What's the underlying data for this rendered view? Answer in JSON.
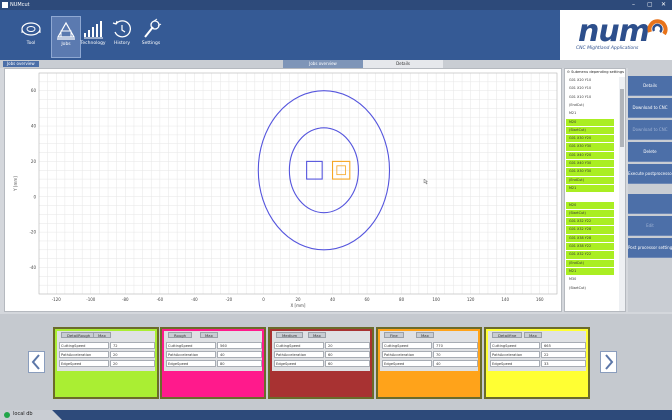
{
  "window": {
    "title": "NUMcut"
  },
  "nav": [
    {
      "label": "Tool",
      "icon": "tool-icon",
      "active": false
    },
    {
      "label": "Jobs",
      "icon": "jobs-icon",
      "active": true
    },
    {
      "label": "Technology",
      "icon": "technology-icon",
      "active": false
    },
    {
      "label": "History",
      "icon": "history-icon",
      "active": false
    },
    {
      "label": "Settings",
      "icon": "settings-icon",
      "active": false
    }
  ],
  "brand": {
    "name": "num",
    "tagline": "CNC Mightland Applications"
  },
  "breadcrumb": "Jobs overview",
  "tabs": [
    {
      "label": "Jobs overview"
    },
    {
      "label": "Details"
    }
  ],
  "plot": {
    "xlabel": "X [mm]",
    "ylabel": "Y [mm]",
    "xticks": [
      "-120",
      "-100",
      "-80",
      "-60",
      "-40",
      "-20",
      "0",
      "20",
      "40",
      "60",
      "80",
      "100",
      "120",
      "140",
      "160"
    ],
    "yticks": [
      "60",
      "40",
      "20",
      "0",
      "-20",
      "-40"
    ],
    "colors": {
      "path": "#5555dd",
      "selected": "#f5a623",
      "grid": "#e6e6e6"
    }
  },
  "program_list": {
    "header": "Submenu depending settings",
    "lines": [
      {
        "text": "G01 X20 Y10",
        "hl": false
      },
      {
        "text": "G01 X20 Y10",
        "hl": false
      },
      {
        "text": "G01 X10 Y10",
        "hl": false
      },
      {
        "text": "(EndCut)",
        "hl": false
      },
      {
        "text": "M21",
        "hl": false
      },
      {
        "text": "M20",
        "hl": true
      },
      {
        "text": "(StartCut)",
        "hl": true
      },
      {
        "text": "G01 X30 Y20",
        "hl": true
      },
      {
        "text": "G01 X30 Y30",
        "hl": true
      },
      {
        "text": "G01 X40 Y20",
        "hl": true
      },
      {
        "text": "G01 X40 Y30",
        "hl": true
      },
      {
        "text": "G01 X30 Y30",
        "hl": true
      },
      {
        "text": "(EndCut)",
        "hl": true
      },
      {
        "text": "M21",
        "hl": true
      },
      {
        "text": "",
        "hl": false
      },
      {
        "text": "M20",
        "hl": true
      },
      {
        "text": "(StartCut)",
        "hl": true
      },
      {
        "text": "G01 X32 Y22",
        "hl": true
      },
      {
        "text": "G01 X32 Y28",
        "hl": true
      },
      {
        "text": "G01 X38 Y28",
        "hl": true
      },
      {
        "text": "G01 X38 Y22",
        "hl": true
      },
      {
        "text": "G01 X32 Y22",
        "hl": true
      },
      {
        "text": "(EndCut)",
        "hl": true
      },
      {
        "text": "M21",
        "hl": true
      },
      {
        "text": "M30",
        "hl": false
      },
      {
        "text": "(StartCut)",
        "hl": false
      }
    ]
  },
  "actions": [
    {
      "label": "Details",
      "disabled": false
    },
    {
      "label": "Download to CNC",
      "disabled": false
    },
    {
      "label": "Download to CNC",
      "disabled": true
    },
    {
      "label": "Delete",
      "disabled": false
    },
    {
      "label": "Execute postprocessor",
      "disabled": false
    },
    {
      "label": "",
      "disabled": true
    },
    {
      "label": "Edit",
      "disabled": true
    },
    {
      "label": "Post processor settings",
      "disabled": false
    }
  ],
  "cards": [
    {
      "name": "DetailRough",
      "max": "Max",
      "color": "#aaee33",
      "rows": [
        {
          "label": "CuttingSpeed",
          "value": "72"
        },
        {
          "label": "PathAcceleration",
          "value": "20"
        },
        {
          "label": "EdgeSpeed",
          "value": "20"
        }
      ]
    },
    {
      "name": "Rough",
      "max": "Max",
      "color": "#ff1a8c",
      "rows": [
        {
          "label": "CuttingSpeed",
          "value": "560"
        },
        {
          "label": "PathAcceleration",
          "value": "40"
        },
        {
          "label": "EdgeSpeed",
          "value": "80"
        }
      ]
    },
    {
      "name": "Medium",
      "max": "Max",
      "color": "#a83232",
      "rows": [
        {
          "label": "CuttingSpeed",
          "value": "20"
        },
        {
          "label": "PathAcceleration",
          "value": "60"
        },
        {
          "label": "EdgeSpeed",
          "value": "60"
        }
      ]
    },
    {
      "name": "Fine",
      "max": "Max",
      "color": "#ffa31a",
      "rows": [
        {
          "label": "CuttingSpeed",
          "value": "770"
        },
        {
          "label": "PathAcceleration",
          "value": "70"
        },
        {
          "label": "EdgeSpeed",
          "value": "40"
        }
      ]
    },
    {
      "name": "Detailfine",
      "max": "Max",
      "color": "#ffff33",
      "rows": [
        {
          "label": "CuttingSpeed",
          "value": "665"
        },
        {
          "label": "PathAcceleration",
          "value": "22"
        },
        {
          "label": "EdgeSpeed",
          "value": "33"
        }
      ]
    }
  ],
  "status": {
    "text": "local db",
    "color": "#22a54a"
  }
}
